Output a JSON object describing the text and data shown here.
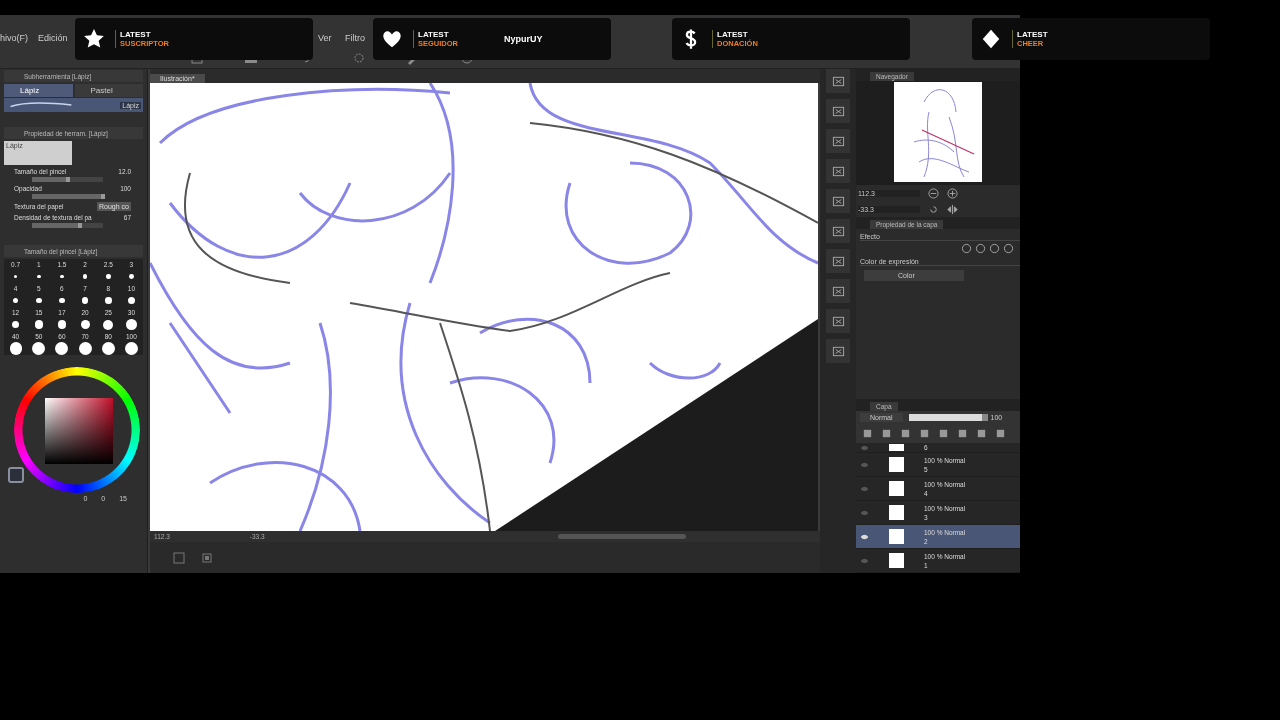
{
  "menu": [
    "hivo(F)",
    "Edición",
    "Ver",
    "Filtro"
  ],
  "alerts": [
    {
      "kind": "star",
      "heading": "LATEST",
      "label": "SUSCRIPTOR"
    },
    {
      "kind": "heart",
      "heading": "LATEST",
      "label": "SEGUIDOR",
      "name": "NypurUY"
    },
    {
      "kind": "dollar",
      "heading": "LATEST",
      "label": "DONACIÓN"
    },
    {
      "kind": "diamond",
      "heading": "LATEST",
      "label": "CHEER"
    }
  ],
  "subtool": {
    "title": "Subherramienta [Lápiz]",
    "tabs": [
      {
        "label": "Lápiz",
        "selected": true
      },
      {
        "label": "Pastel",
        "selected": false
      }
    ],
    "brush": "Lápiz"
  },
  "tool_property": {
    "title": "Propiedad de herram. [Lápiz]",
    "preview_label": "Lápiz",
    "rows": [
      {
        "kind": "slider",
        "label": "Tamaño del pincel",
        "value": "12.0",
        "level": 0.5
      },
      {
        "kind": "slider",
        "label": "Opacidad",
        "value": "100",
        "level": 1
      },
      {
        "kind": "texture",
        "label": "Textura del papel",
        "value": "Rough co"
      },
      {
        "kind": "slider",
        "label": "Densidad de textura del pa",
        "value": "67",
        "level": 0.67
      }
    ]
  },
  "brush_size": {
    "title": "Tamaño del pincel [Lápiz]",
    "sizes": [
      "0.7",
      "1",
      "1.5",
      "2",
      "2.5",
      "3",
      "4",
      "5",
      "6",
      "7",
      "8",
      "10",
      "12",
      "15",
      "17",
      "20",
      "25",
      "30",
      "40",
      "50",
      "60",
      "70",
      "80",
      "100"
    ]
  },
  "color_values": [
    "0",
    "0",
    "15"
  ],
  "canvas": {
    "tab": "Ilustración*",
    "zoom": "112.3",
    "angle": "-33.3"
  },
  "navigator": {
    "title": "Navegador",
    "zoom": "112.3",
    "angle": "-33.3"
  },
  "layer_property": {
    "title": "Propiedad de la capa",
    "effect_label": "Efecto",
    "expression_label": "Color de expresión",
    "expression_value": "Color"
  },
  "layers": {
    "title": "Capa",
    "blend_mode": "Normal",
    "opacity": "100",
    "level": 1,
    "items": [
      {
        "name": "6",
        "selected": false
      },
      {
        "blend": "100 % Normal",
        "name": "5",
        "selected": false
      },
      {
        "blend": "100 % Normal",
        "name": "4",
        "selected": false
      },
      {
        "blend": "100 % Normal",
        "name": "3",
        "selected": false
      },
      {
        "blend": "100 % Normal",
        "name": "2",
        "selected": true
      },
      {
        "blend": "100 % Normal",
        "name": "1",
        "selected": false
      }
    ]
  }
}
